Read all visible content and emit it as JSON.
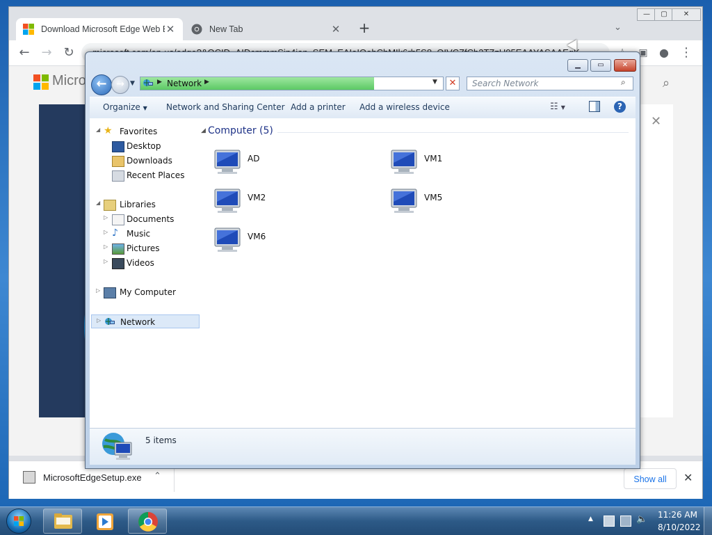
{
  "browser": {
    "tabs": [
      {
        "title": "Download Microsoft Edge Web B",
        "active": true
      },
      {
        "title": "New Tab",
        "active": false
      }
    ],
    "url": "microsoft.com/en-us/edge?&OCID=AIDcmmmSin4ian_SEM_EAIaIQobChMIk6rh5S8_QIVCZfCb2TZzU05EAAYASAAEgK",
    "page": {
      "brand": "Micro"
    },
    "downloads": {
      "file": "MicrosoftEdgeSetup.exe",
      "show_all": "Show all"
    }
  },
  "explorer": {
    "address": {
      "location": "Network"
    },
    "search_placeholder": "Search Network",
    "toolbar": {
      "organize": "Organize",
      "network_sharing": "Network and Sharing Center",
      "add_printer": "Add a printer",
      "add_wireless": "Add a wireless device"
    },
    "nav": {
      "favorites": "Favorites",
      "desktop": "Desktop",
      "downloads": "Downloads",
      "recent_places": "Recent Places",
      "libraries": "Libraries",
      "documents": "Documents",
      "music": "Music",
      "pictures": "Pictures",
      "videos": "Videos",
      "my_computer": "My Computer",
      "network": "Network"
    },
    "group": "Computer (5)",
    "computers": [
      "AD",
      "VM1",
      "VM2",
      "VM5",
      "VM6"
    ],
    "status": "5 items"
  },
  "taskbar": {
    "time": "11:26 AM",
    "date": "8/10/2022"
  },
  "colors": {
    "aero_blue": "#2b6fb8",
    "progress_green": "#5cc964",
    "selected_nav": "#dce9f8",
    "link_blue": "#1a73e8"
  }
}
